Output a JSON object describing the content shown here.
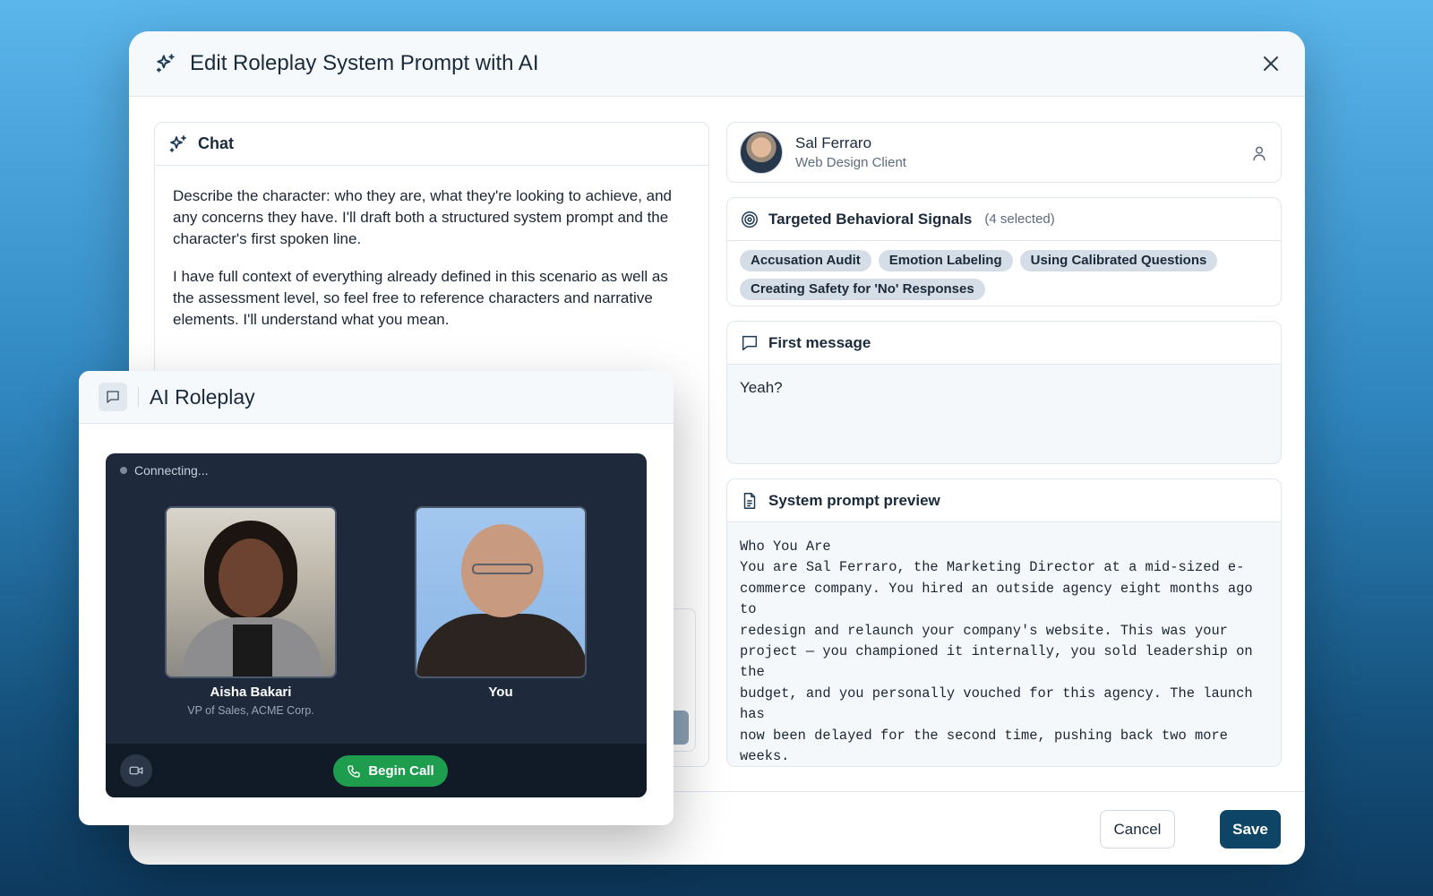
{
  "modal": {
    "title": "Edit Roleplay System Prompt with AI"
  },
  "chat": {
    "header": "Chat",
    "paragraphs": [
      "Describe the character: who they are, what they're looking to achieve, and any concerns they have. I'll draft both a structured system prompt and the character's first spoken line.",
      "I have full context of everything already defined in this scenario as well as the assessment level, so feel free to reference characters and narrative elements. I'll understand what you mean."
    ]
  },
  "persona": {
    "name": "Sal Ferraro",
    "role": "Web Design Client"
  },
  "signals": {
    "header": "Targeted Behavioral Signals",
    "count_label": "(4 selected)",
    "chips": [
      "Accusation Audit",
      "Emotion Labeling",
      "Using Calibrated Questions",
      "Creating Safety for 'No' Responses"
    ]
  },
  "first_message": {
    "header": "First message",
    "text": "Yeah?"
  },
  "system_prompt": {
    "header": "System prompt preview",
    "text": "Who You Are\nYou are Sal Ferraro, the Marketing Director at a mid-sized e-\ncommerce company. You hired an outside agency eight months ago to\nredesign and relaunch your company's website. This was your\nproject — you championed it internally, you sold leadership on the\nbudget, and you personally vouched for this agency. The launch has\nnow been delayed for the second time, pushing back two more weeks.\nYou just found out an hour ago. You haven't responded to their\nemails because you didn't know what to say without saying\nsomething you'd regret.\nYour boss asked you in a meeting this morning in front of three"
  },
  "footer": {
    "cancel_label": "Cancel",
    "save_label": "Save"
  },
  "roleplay": {
    "title": "AI Roleplay",
    "status": "Connecting...",
    "participants": [
      {
        "name": "Aisha Bakari",
        "role": "VP of Sales, ACME Corp."
      },
      {
        "name": "You",
        "role": ""
      }
    ],
    "begin_call_label": "Begin Call"
  },
  "icons": {
    "title": "sparkles-icon",
    "close": "close-icon",
    "chat": "sparkles-icon",
    "persona": "user-icon",
    "signals": "target-icon",
    "first_message": "message-square-icon",
    "preview": "file-text-icon",
    "roleplay": "message-square-icon",
    "camera": "video-camera-icon",
    "phone": "phone-icon"
  },
  "colors": {
    "primary": "#0e4466",
    "call_green": "#1f9d4f",
    "call_bg": "#1e2a3c"
  }
}
